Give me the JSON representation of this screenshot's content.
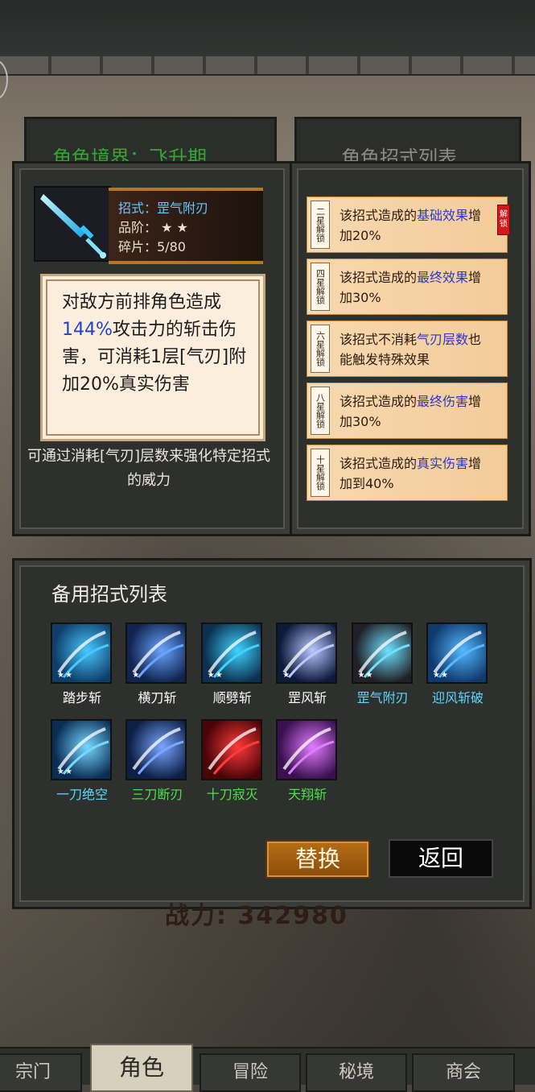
{
  "behind": {
    "realm_label": "角色境界：飞升期",
    "skill_list_label": "角色招式列表",
    "power_value": "342980"
  },
  "current_skill": {
    "name_line": "招式：罡气附刃",
    "grade_label": "品阶：",
    "grade_stars": 2,
    "fragments_line": "碎片：5/80",
    "desc_part1": "对敌方前排角色造成",
    "desc_highlight": "144%",
    "desc_part2": "攻击力的斩击伤害，可消耗1层[气刃]附加20%真实伤害",
    "hint": "可通过消耗[气刃]层数来强化特定招式的威力"
  },
  "unlocks": [
    {
      "tag": "二星解锁",
      "pre": "该招式造成的",
      "hl": "基础效果",
      "post": "增加20%"
    },
    {
      "tag": "四星解锁",
      "pre": "该招式造成的",
      "hl": "最终效果",
      "post": "增加30%"
    },
    {
      "tag": "六星解锁",
      "pre": "该招式不消耗",
      "hl": "气刃层数",
      "post": "也能触发特殊效果"
    },
    {
      "tag": "八星解锁",
      "pre": "该招式造成的",
      "hl": "最终伤害",
      "post": "增加30%"
    },
    {
      "tag": "十星解锁",
      "pre": "该招式造成的",
      "hl": "真实伤害",
      "post": "增加到40%"
    }
  ],
  "unlock_seal": "解锁",
  "spare": {
    "title": "备用招式列表",
    "skills": [
      {
        "name": "踏步斩",
        "stars": 2,
        "color": "#ffffff",
        "icon": "blade-dash-icon",
        "c1": "#0e3f6b",
        "c2": "#48c8ff"
      },
      {
        "name": "横刀斩",
        "stars": 1,
        "color": "#ffffff",
        "icon": "horizontal-slash-icon",
        "c1": "#10244f",
        "c2": "#68a4ff"
      },
      {
        "name": "顺劈斩",
        "stars": 2,
        "color": "#ffffff",
        "icon": "cleave-icon",
        "c1": "#0c3150",
        "c2": "#3fd2ff"
      },
      {
        "name": "罡风斩",
        "stars": 1,
        "color": "#ffffff",
        "icon": "wind-slash-icon",
        "c1": "#0c1a3c",
        "c2": "#b8c8ff"
      },
      {
        "name": "罡气附刃",
        "stars": 2,
        "color": "#5ad7ff",
        "icon": "sword-icon",
        "c1": "#202026",
        "c2": "#6fe0ff"
      },
      {
        "name": "迎风斩破",
        "stars": 2,
        "color": "#5ad7ff",
        "icon": "ninja-slash-icon",
        "c1": "#0f3a6d",
        "c2": "#56b7ff"
      },
      {
        "name": "一刀绝空",
        "stars": 2,
        "color": "#5ad7ff",
        "icon": "void-slash-icon",
        "c1": "#0a2d55",
        "c2": "#77d8ff"
      },
      {
        "name": "三刀断刃",
        "stars": 0,
        "color": "#4be04b",
        "icon": "triple-slash-icon",
        "c1": "#0c1f45",
        "c2": "#7aa6ff"
      },
      {
        "name": "十刀寂灭",
        "stars": 0,
        "color": "#4be04b",
        "icon": "cross-slash-icon",
        "c1": "#4a0408",
        "c2": "#ff3a3a"
      },
      {
        "name": "天翔斩",
        "stars": 0,
        "color": "#4be04b",
        "icon": "sky-slash-icon",
        "c1": "#3a1050",
        "c2": "#e27cff"
      }
    ]
  },
  "buttons": {
    "replace": "替换",
    "back": "返回"
  },
  "nav": {
    "tabs": [
      "宗门",
      "角色",
      "冒险",
      "秘境",
      "商会"
    ]
  }
}
